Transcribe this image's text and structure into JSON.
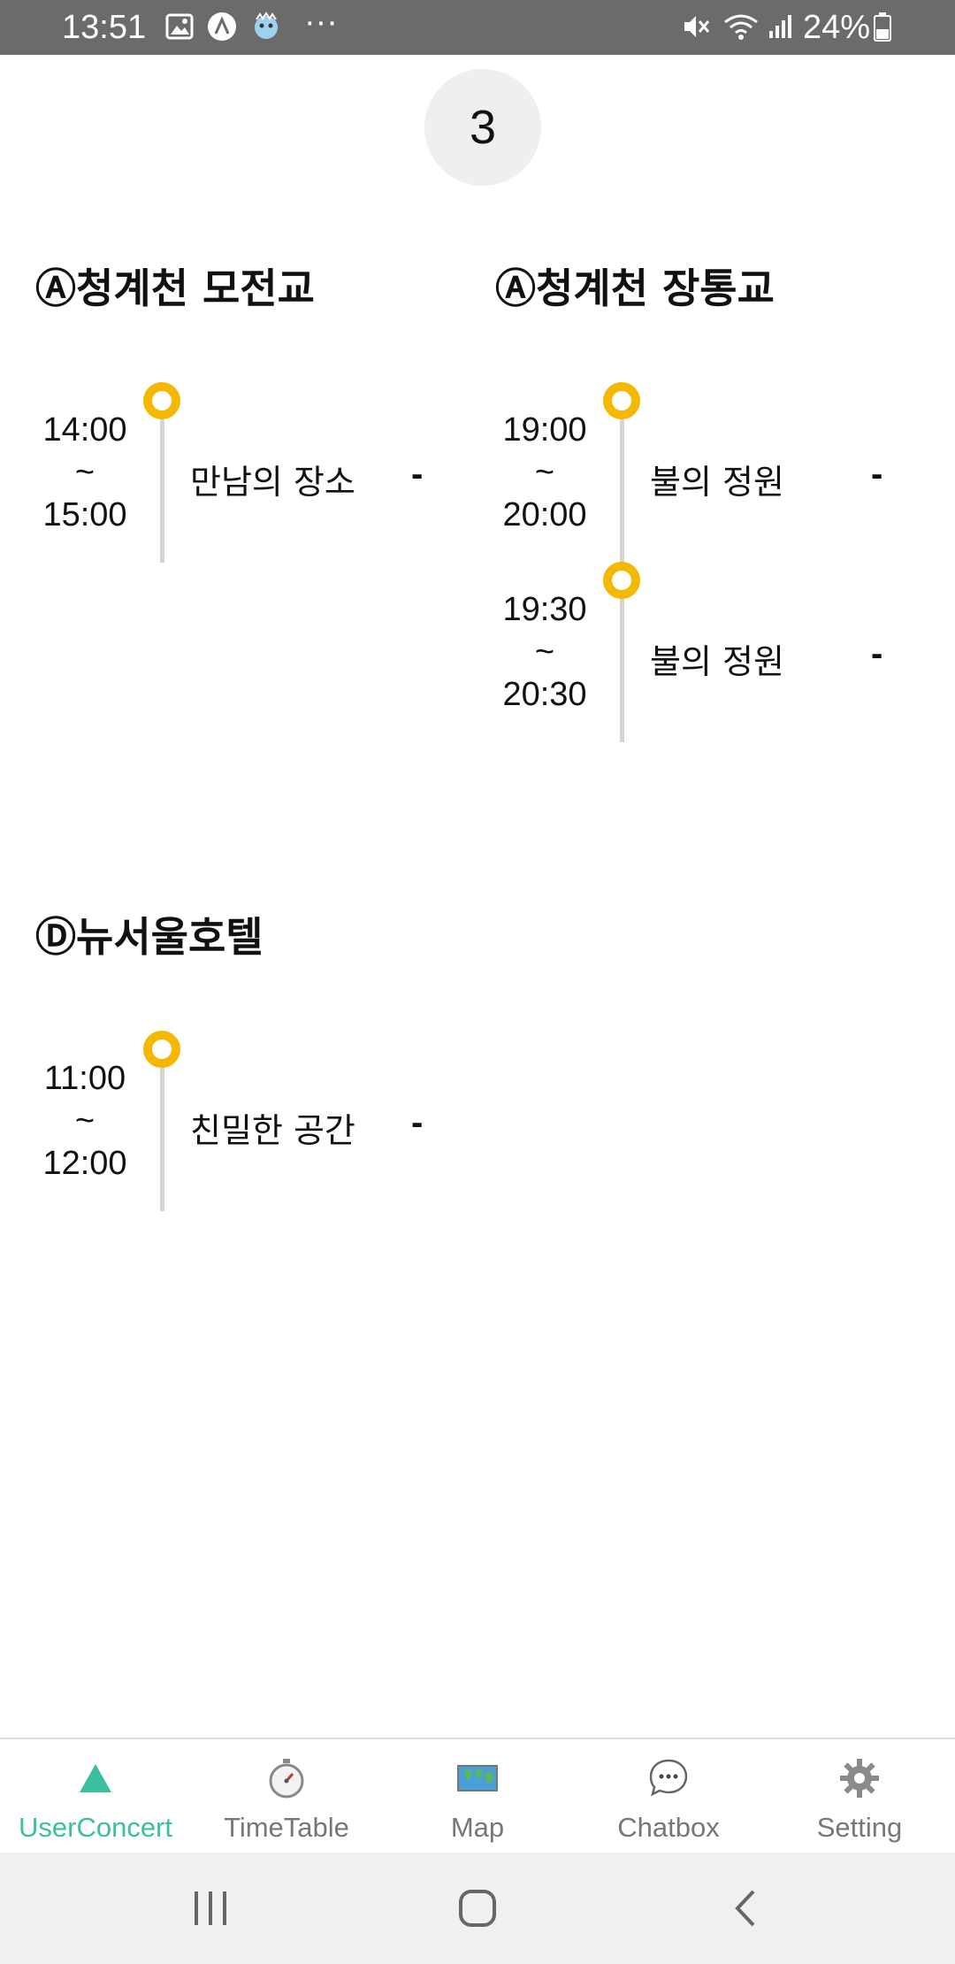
{
  "status_bar": {
    "time": "13:51",
    "battery_percent": "24%",
    "more_dots": "···"
  },
  "day_badge": "3",
  "stages": [
    {
      "title": "Ⓐ청계천 모전교",
      "events": [
        {
          "start": "14:00",
          "sep": "~",
          "end": "15:00",
          "name": "만남의 장소",
          "dash": "-"
        }
      ]
    },
    {
      "title": "Ⓐ청계천 장통교",
      "events": [
        {
          "start": "19:00",
          "sep": "~",
          "end": "20:00",
          "name": "불의 정원",
          "dash": "-"
        },
        {
          "start": "19:30",
          "sep": "~",
          "end": "20:30",
          "name": "불의 정원",
          "dash": "-"
        }
      ]
    },
    {
      "title": "Ⓓ뉴서울호텔",
      "events": [
        {
          "start": "11:00",
          "sep": "~",
          "end": "12:00",
          "name": "친밀한 공간",
          "dash": "-"
        }
      ]
    }
  ],
  "bottom_nav": {
    "items": [
      {
        "label": "UserConcert",
        "icon": "triangle-icon",
        "active": true
      },
      {
        "label": "TimeTable",
        "icon": "stopwatch-icon",
        "active": false
      },
      {
        "label": "Map",
        "icon": "world-map-icon",
        "active": false
      },
      {
        "label": "Chatbox",
        "icon": "chat-bubble-icon",
        "active": false
      },
      {
        "label": "Setting",
        "icon": "gear-icon",
        "active": false
      }
    ]
  },
  "colors": {
    "accent": "#3cbfa1",
    "timeline_dot": "#f5b800",
    "status_bar": "#6b6b6b"
  }
}
